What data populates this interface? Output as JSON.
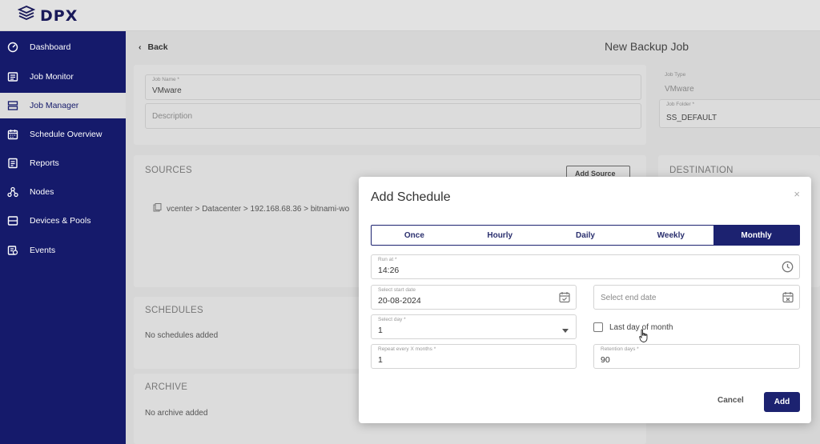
{
  "app": {
    "logo_text": "DPX"
  },
  "sidebar": {
    "items": [
      {
        "label": "Dashboard",
        "icon": "dashboard-icon"
      },
      {
        "label": "Job Monitor",
        "icon": "monitor-icon"
      },
      {
        "label": "Job Manager",
        "icon": "job-manager-icon",
        "active": true
      },
      {
        "label": "Schedule Overview",
        "icon": "calendar-icon"
      },
      {
        "label": "Reports",
        "icon": "reports-icon"
      },
      {
        "label": "Nodes",
        "icon": "nodes-icon"
      },
      {
        "label": "Devices & Pools",
        "icon": "devices-icon"
      },
      {
        "label": "Events",
        "icon": "events-icon"
      }
    ]
  },
  "header": {
    "back_label": "Back",
    "page_title": "New Backup Job"
  },
  "job_form": {
    "job_name_label": "Job Name *",
    "job_name_value": "VMware",
    "description_placeholder": "Description",
    "job_type_label": "Job Type",
    "job_type_value": "VMware",
    "job_folder_label": "Job Folder *",
    "job_folder_value": "SS_DEFAULT"
  },
  "sources": {
    "title": "SOURCES",
    "add_button": "Add Source",
    "path": "vcenter > Datacenter > 192.168.68.36 > bitnami-wo"
  },
  "destination": {
    "title": "DESTINATION"
  },
  "schedules": {
    "title": "SCHEDULES",
    "empty_text": "No schedules added"
  },
  "archive": {
    "title": "ARCHIVE",
    "empty_text": "No archive added"
  },
  "modal": {
    "title": "Add Schedule",
    "close": "×",
    "tabs": [
      {
        "label": "Once"
      },
      {
        "label": "Hourly"
      },
      {
        "label": "Daily"
      },
      {
        "label": "Weekly"
      },
      {
        "label": "Monthly",
        "active": true
      }
    ],
    "run_at": {
      "label": "Run at *",
      "value": "14:26"
    },
    "start_date": {
      "label": "Select start date",
      "value": "20-08-2024"
    },
    "end_date": {
      "placeholder": "Select end date"
    },
    "select_day": {
      "label": "Select day *",
      "value": "1"
    },
    "last_day_of_month": {
      "label": "Last day of month",
      "checked": false
    },
    "repeat": {
      "label": "Repeat every X months *",
      "value": "1"
    },
    "retention": {
      "label": "Retention days *",
      "value": "90"
    },
    "cancel_label": "Cancel",
    "add_label": "Add"
  },
  "colors": {
    "brand": "#151a6b",
    "accent": "#1c2270",
    "overlay": "#d6d6d6"
  }
}
